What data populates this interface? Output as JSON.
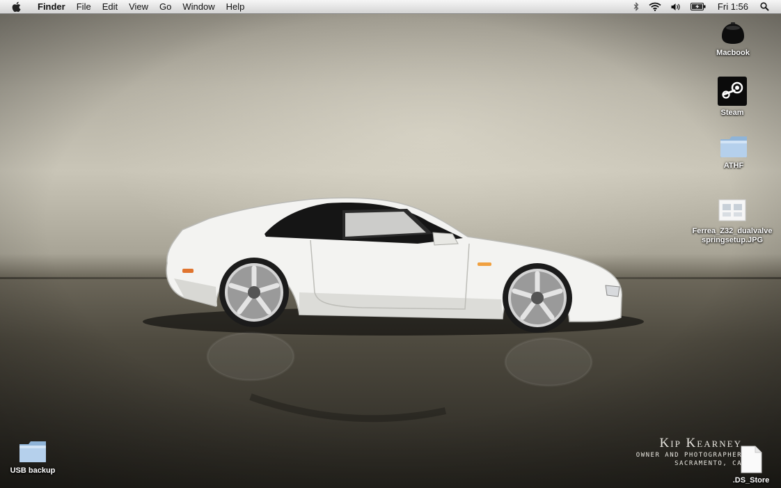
{
  "menubar": {
    "apple_icon": "apple-logo-icon",
    "app_name": "Finder",
    "menus": [
      "File",
      "Edit",
      "View",
      "Go",
      "Window",
      "Help"
    ],
    "status": {
      "bluetooth_icon": "bluetooth-icon",
      "wifi_icon": "wifi-icon",
      "volume_icon": "volume-icon",
      "battery_icon": "battery-charging-icon",
      "clock": "Fri 1:56",
      "spotlight_icon": "spotlight-search-icon"
    }
  },
  "desktop_icons": [
    {
      "label": "Macbook",
      "icon": "hard-drive-icon"
    },
    {
      "label": "Steam",
      "icon": "steam-icon"
    },
    {
      "label": "ATHF",
      "icon": "folder-icon"
    },
    {
      "label_line1": "Ferrea_Z32_dualvalve",
      "label_line2": "springsetup.JPG",
      "icon": "jpg-file-icon"
    },
    {
      "label": "USB backup",
      "icon": "folder-icon"
    },
    {
      "label": ".DS_Store",
      "icon": "document-icon"
    }
  ],
  "wallpaper": {
    "watermark_name": "Kip Kearney",
    "watermark_role": "OWNER AND PHOTOGRAPHER",
    "watermark_city": "SACRAMENTO, CA",
    "colors": {
      "wall": "#c9c5b7",
      "floor": "#3a372f",
      "car_body": "#f4f4f2"
    }
  }
}
